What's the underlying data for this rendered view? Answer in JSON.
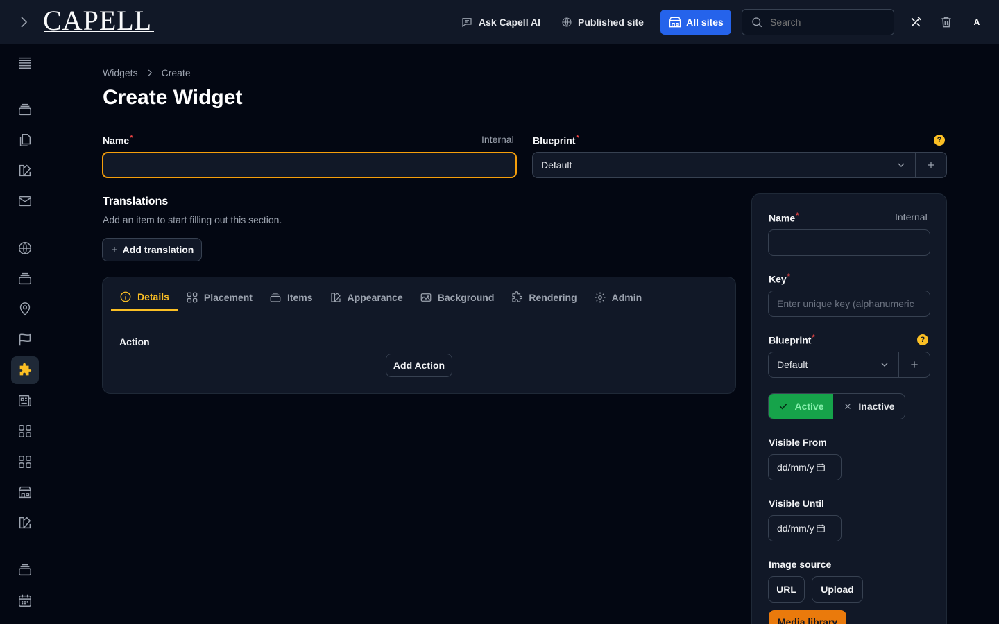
{
  "topbar": {
    "logo": "CAPELL",
    "ask_ai": "Ask Capell AI",
    "published_site": "Published site",
    "all_sites": "All sites",
    "search_placeholder": "Search",
    "avatar_initial": "A"
  },
  "breadcrumb": {
    "parent": "Widgets",
    "current": "Create"
  },
  "page_title": "Create Widget",
  "form": {
    "name_label": "Name",
    "name_hint": "Internal",
    "name_value": "",
    "blueprint_label": "Blueprint",
    "blueprint_value": "Default"
  },
  "translations": {
    "title": "Translations",
    "description": "Add an item to start filling out this section.",
    "add_button": "Add translation"
  },
  "tabs": [
    {
      "label": "Details",
      "icon": "info-icon",
      "active": true
    },
    {
      "label": "Placement",
      "icon": "grid-icon"
    },
    {
      "label": "Items",
      "icon": "stack-icon"
    },
    {
      "label": "Appearance",
      "icon": "swatch-icon"
    },
    {
      "label": "Background",
      "icon": "image-icon"
    },
    {
      "label": "Rendering",
      "icon": "puzzle-icon"
    },
    {
      "label": "Admin",
      "icon": "gear-icon"
    }
  ],
  "details": {
    "action_label": "Action",
    "add_action": "Add Action"
  },
  "side_panel": {
    "name_label": "Name",
    "name_hint": "Internal",
    "key_label": "Key",
    "key_placeholder": "Enter unique key (alphanumeric",
    "blueprint_label": "Blueprint",
    "blueprint_value": "Default",
    "active_label": "Active",
    "inactive_label": "Inactive",
    "visible_from_label": "Visible From",
    "visible_until_label": "Visible Until",
    "date_placeholder": "dd/mm/y",
    "image_source_label": "Image source",
    "url_button": "URL",
    "upload_button": "Upload",
    "media_library_button": "Media library"
  },
  "colors": {
    "accent": "#fbbf24",
    "primary": "#2563eb",
    "success": "#16a34a",
    "focus": "#f59e0b",
    "media": "#ea7a0c"
  }
}
